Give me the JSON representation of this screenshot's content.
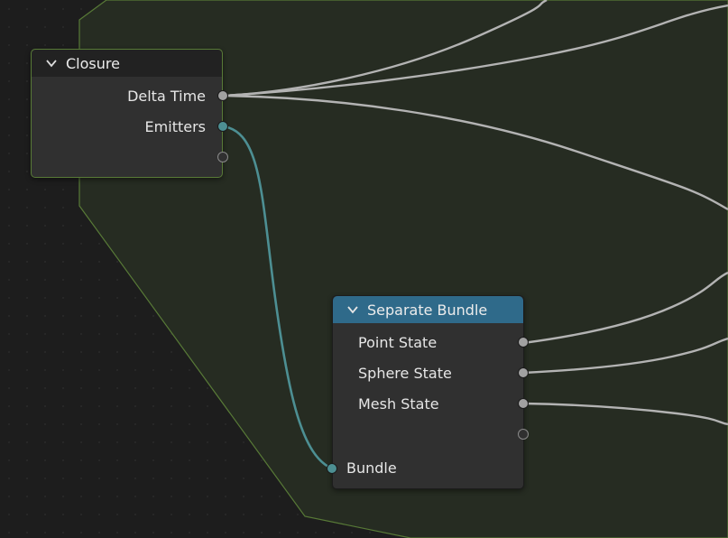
{
  "colors": {
    "canvas_background": "#1d1d1d",
    "frame_fill": "#262c22",
    "frame_border": "#587a37",
    "node_body": "#303030",
    "closure_header": "#222222",
    "separate_bundle_header": "#2f6a8a",
    "float_socket": "#a1a1a1",
    "bundle_socket": "#4d8f93",
    "float_link": "#b3b3b3",
    "bundle_link": "#4d8f93"
  },
  "closure_node": {
    "title": "Closure",
    "collapse_icon": "chevron-down-icon",
    "outputs": [
      {
        "label": "Delta Time",
        "socket": "float"
      },
      {
        "label": "Emitters",
        "socket": "bundle"
      },
      {
        "label": "",
        "socket": "empty"
      }
    ]
  },
  "separate_bundle_node": {
    "title": "Separate Bundle",
    "collapse_icon": "chevron-down-icon",
    "outputs": [
      {
        "label": "Point State",
        "socket": "float"
      },
      {
        "label": "Sphere State",
        "socket": "float"
      },
      {
        "label": "Mesh State",
        "socket": "float"
      },
      {
        "label": "",
        "socket": "empty"
      }
    ],
    "inputs": [
      {
        "label": "Bundle",
        "socket": "bundle"
      }
    ]
  }
}
